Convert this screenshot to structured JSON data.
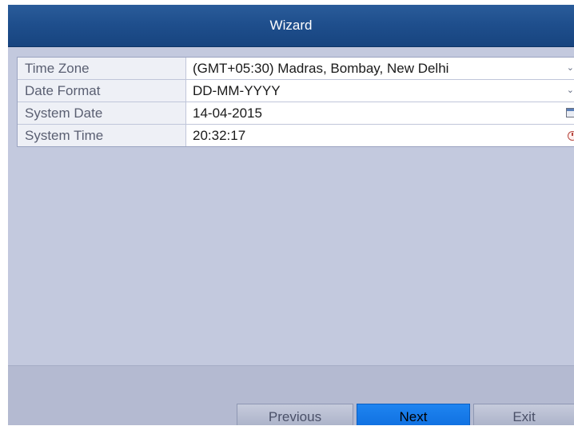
{
  "window": {
    "title": "Wizard"
  },
  "form": {
    "rows": [
      {
        "label": "Time Zone",
        "value": "(GMT+05:30) Madras, Bombay, New Delhi",
        "trailing_icon": "chevron-down-icon"
      },
      {
        "label": "Date Format",
        "value": "DD-MM-YYYY",
        "trailing_icon": "chevron-down-icon"
      },
      {
        "label": "System Date",
        "value": "14-04-2015",
        "trailing_icon": "calendar-icon"
      },
      {
        "label": "System Time",
        "value": "20:32:17",
        "trailing_icon": "clock-icon"
      }
    ]
  },
  "footer": {
    "previous_label": "Previous",
    "next_label": "Next",
    "exit_label": "Exit"
  },
  "colors": {
    "titlebar": "#1f4f8d",
    "panel": "#c3c9de",
    "primary_button": "#0f6fe0"
  }
}
